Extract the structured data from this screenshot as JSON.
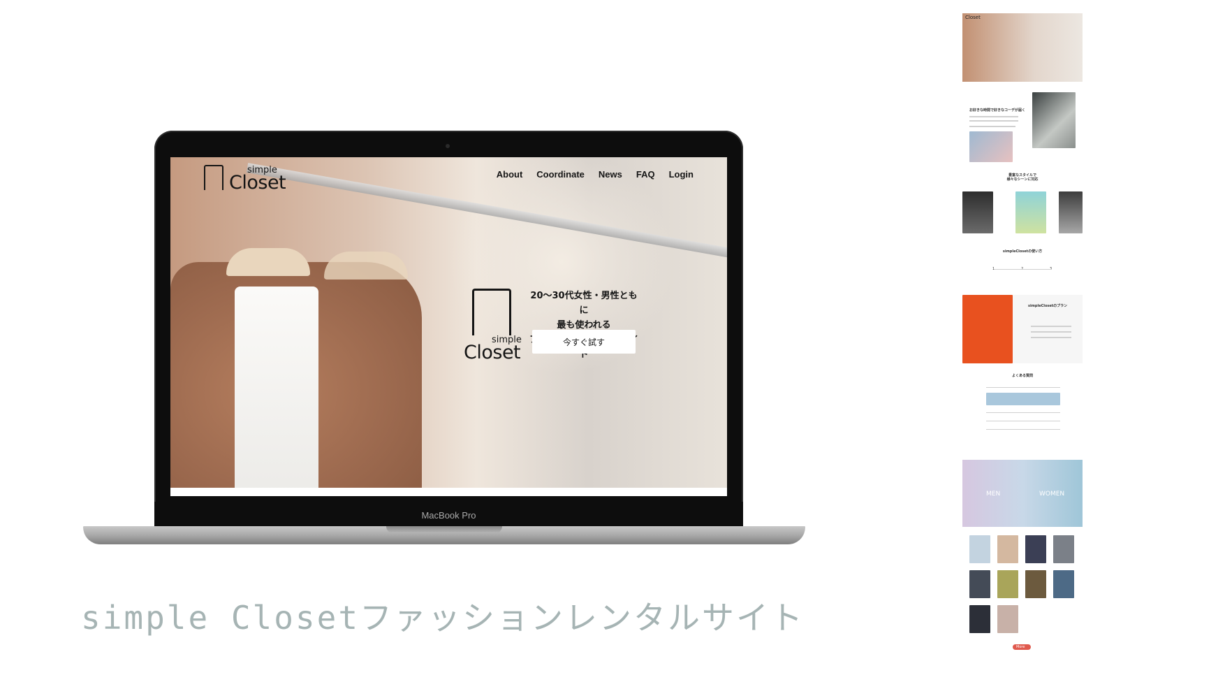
{
  "site": {
    "logo_small": "simple",
    "logo_big": "Closet",
    "nav": [
      "About",
      "Coordinate",
      "News",
      "FAQ",
      "Login"
    ],
    "hero_lines": [
      "20〜30代女性・男性ともに",
      "最も使われる",
      "ファッションレンタルサイト"
    ],
    "cta": "今すぐ試す"
  },
  "device_label": "MacBook Pro",
  "caption": "simple Closetファッションレンタルサイト",
  "preview": {
    "section_about_title": "お好きな時間で好きなコーデが届く",
    "section_style_title": "豊富なスタイルで\n様々なシーンに対応",
    "section_howto_title": "simpleClosetの使い方",
    "howto_steps": [
      "1",
      "2",
      "3"
    ],
    "section_plan_title": "simpleClosetのプラン",
    "section_faq_title": "よくある質問",
    "men_label": "MEN",
    "women_label": "WOMEN",
    "more_button": "More"
  },
  "colors": {
    "caption": "#a6b4b4",
    "plan_image": "#e8511f",
    "faq_highlight": "#a9c7dc",
    "more_button": "#e05a4e"
  }
}
